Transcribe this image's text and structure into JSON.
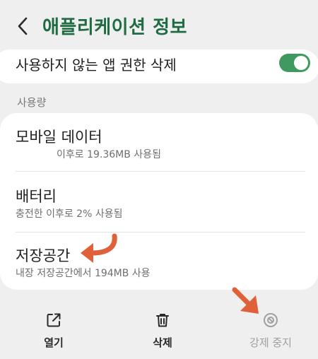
{
  "header": {
    "title": "애플리케이션 정보"
  },
  "unused_permissions": {
    "label": "사용하지 않는 앱 권한 삭제",
    "enabled": true
  },
  "usage_section": {
    "header": "사용량",
    "rows": [
      {
        "title": "모바일 데이터",
        "subtitle": "이후로 19.36MB 사용됨"
      },
      {
        "title": "배터리",
        "subtitle": "충전한 이후로 2% 사용됨"
      },
      {
        "title": "저장공간",
        "subtitle": "내장 저장공간에서 194MB 사용"
      }
    ]
  },
  "bottom_actions": [
    {
      "label": "열기",
      "icon": "open-external-icon",
      "enabled": true
    },
    {
      "label": "삭제",
      "icon": "trash-icon",
      "enabled": true
    },
    {
      "label": "강제 중지",
      "icon": "block-icon",
      "enabled": false
    }
  ],
  "colors": {
    "accent": "#1f6b42",
    "toggle_on": "#3f9a60",
    "annotation": "#e0603a"
  }
}
